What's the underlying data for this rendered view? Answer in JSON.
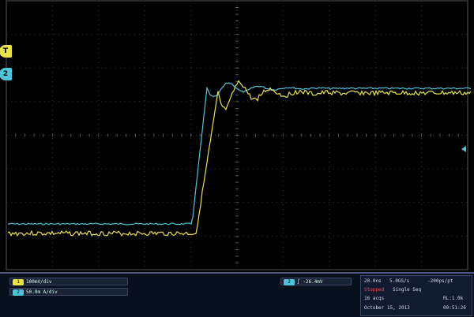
{
  "channels": [
    {
      "tag": "1",
      "scale": "100mV/div",
      "color": "#e9e24a"
    },
    {
      "tag": "2",
      "scale": "50.0m A/div",
      "color": "#4fc3d9"
    }
  ],
  "trigger": {
    "tag": "2",
    "symbol": "∫",
    "level": "-26.4mV"
  },
  "acquisition": {
    "timebase": "20.0ns",
    "sample_rate": "5.0GS/s",
    "pos": "-200ps/pt",
    "state": "Stopped",
    "mode": "Single Seq",
    "acqs": "16 acqs",
    "record_length": "RL:1.0k",
    "date": "October 15, 2013",
    "time": "00:51:26"
  },
  "markers": {
    "trigger_label": "T",
    "ch2_label": "2"
  },
  "colors": {
    "grid": "#3a3a3a",
    "ch1": "#e9e24a",
    "ch2": "#4fc3d9"
  }
}
